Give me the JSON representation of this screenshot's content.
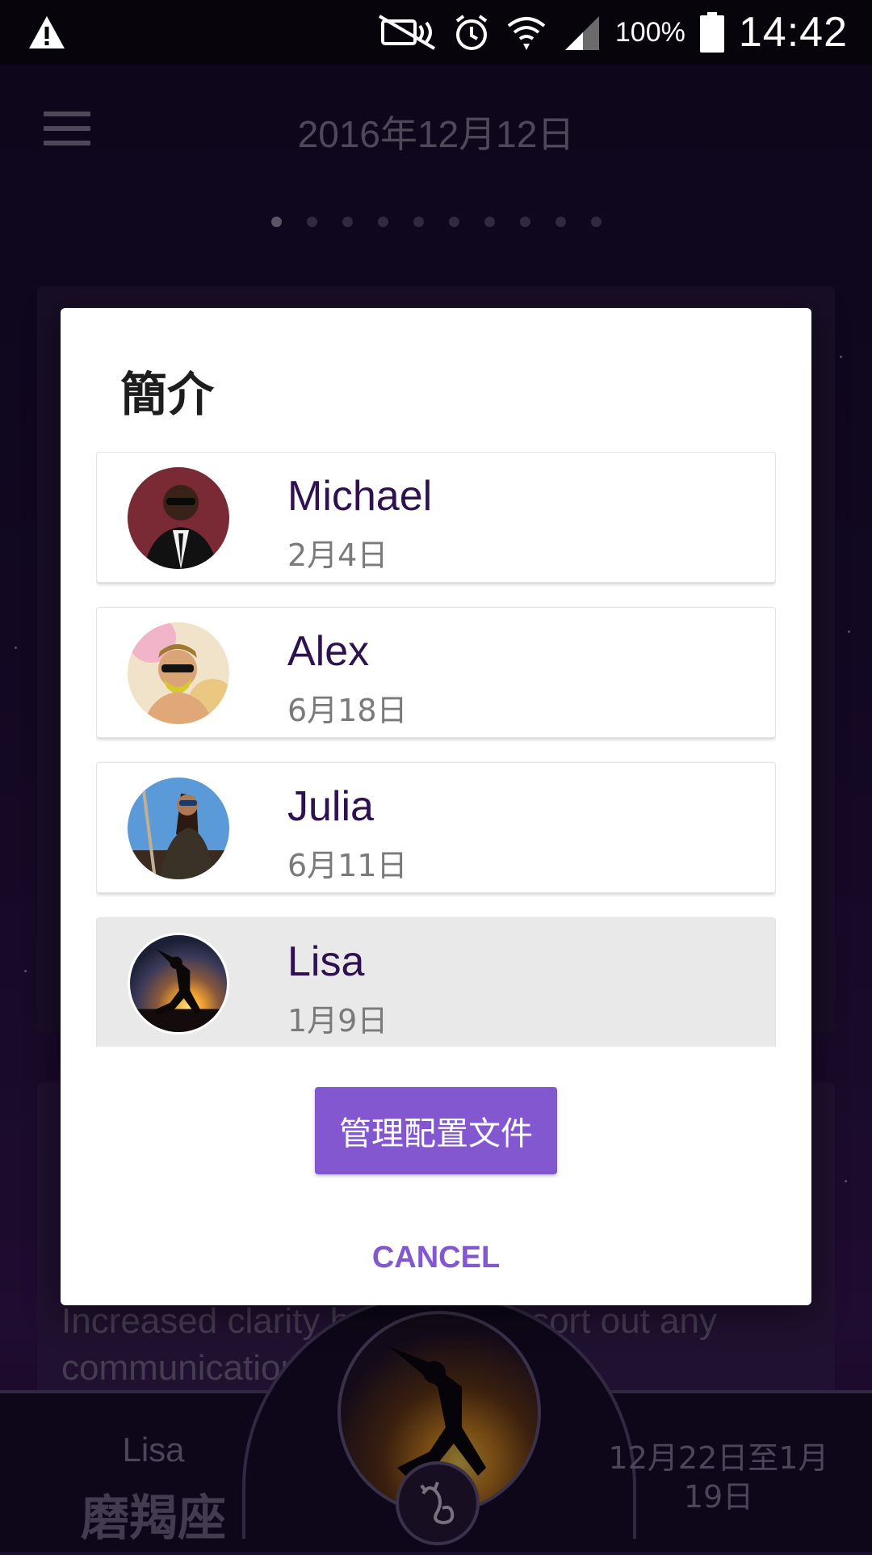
{
  "status_bar": {
    "battery_percent": "100%",
    "time": "14:42",
    "icons": [
      "warning-icon",
      "mute-icon",
      "alarm-icon",
      "wifi-icon",
      "signal-icon",
      "battery-icon"
    ]
  },
  "app": {
    "title": "2016年12月12日",
    "pager": {
      "count": 10,
      "active_index": 0
    },
    "background_text": "Increased clarity helps you to sort out any communication or",
    "footer": {
      "profile_name": "Lisa",
      "zodiac_sign": "磨羯座",
      "zodiac_dates": "12月22日至1月19日"
    }
  },
  "dialog": {
    "title": "簡介",
    "profiles": [
      {
        "name": "Michael",
        "date": "2月4日",
        "selected": false
      },
      {
        "name": "Alex",
        "date": "6月18日",
        "selected": false
      },
      {
        "name": "Julia",
        "date": "6月11日",
        "selected": false
      },
      {
        "name": "Lisa",
        "date": "1月9日",
        "selected": true
      }
    ],
    "manage_button_label": "管理配置文件",
    "cancel_label": "CANCEL"
  },
  "colors": {
    "accent": "#8357cf",
    "profile_name": "#2e1150",
    "selected_row": "#e9e9e9"
  }
}
